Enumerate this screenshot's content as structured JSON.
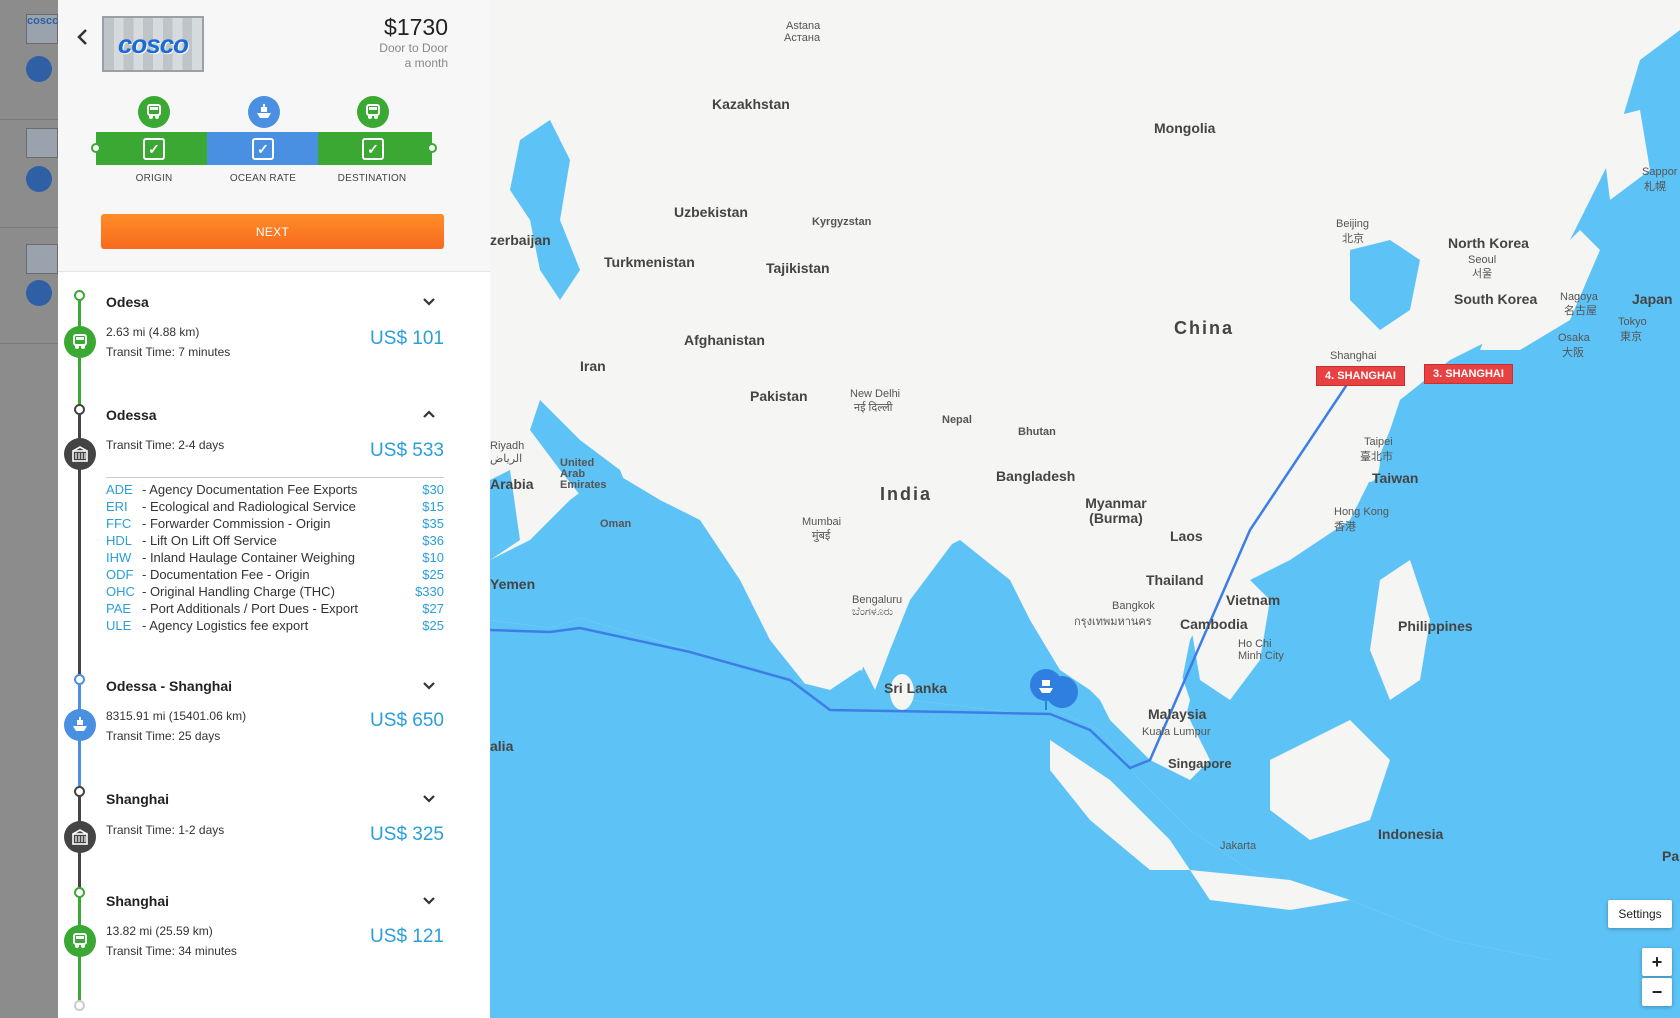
{
  "quote": {
    "carrier_logo_text": "cosco",
    "price": "$1730",
    "service": "Door to Door",
    "period": "a month"
  },
  "steps": [
    {
      "label": "ORIGIN",
      "color": "#3aa832",
      "icon": "truck-icon"
    },
    {
      "label": "OCEAN RATE",
      "color": "#4a90e2",
      "icon": "ship-icon"
    },
    {
      "label": "DESTINATION",
      "color": "#3aa832",
      "icon": "truck-icon"
    }
  ],
  "next_label": "NEXT",
  "legs": [
    {
      "title": "Odesa",
      "info1": "2.63 mi (4.88 km)",
      "info2": "Transit Time: 7 minutes",
      "price": "US$ 101",
      "icon": "truck-icon"
    },
    {
      "title": "Odessa",
      "info1": "Transit Time: 2-4 days",
      "price": "US$ 533",
      "icon": "port-icon",
      "expanded": true
    },
    {
      "title": "Odessa - Shanghai",
      "info1": "8315.91 mi (15401.06 km)",
      "info2": "Transit Time: 25 days",
      "price": "US$ 650",
      "icon": "ship-icon"
    },
    {
      "title": "Shanghai",
      "info1": "Transit Time: 1-2 days",
      "price": "US$ 325",
      "icon": "port-icon"
    },
    {
      "title": "Shanghai",
      "info1": "13.82 mi (25.59 km)",
      "info2": "Transit Time: 34 minutes",
      "price": "US$ 121",
      "icon": "truck-icon"
    }
  ],
  "fees": [
    {
      "code": "ADE",
      "name": "- Agency Documentation Fee Exports",
      "amount": "$30"
    },
    {
      "code": "ERI",
      "name": "- Ecological and Radiological Service",
      "amount": "$15"
    },
    {
      "code": "FFC",
      "name": "- Forwarder Commission - Origin",
      "amount": "$35"
    },
    {
      "code": "HDL",
      "name": "- Lift On Lift Off Service",
      "amount": "$36"
    },
    {
      "code": "IHW",
      "name": "- Inland Haulage Container Weighing",
      "amount": "$10"
    },
    {
      "code": "ODF",
      "name": "- Documentation Fee - Origin",
      "amount": "$25"
    },
    {
      "code": "OHC",
      "name": "- Original Handling Charge (THC)",
      "amount": "$330"
    },
    {
      "code": "PAE",
      "name": "- Port Additionals / Port Dues - Export",
      "amount": "$27"
    },
    {
      "code": "ULE",
      "name": "- Agency Logistics fee export",
      "amount": "$25"
    }
  ],
  "map": {
    "countries": [
      "Kazakhstan",
      "Mongolia",
      "Uzbekistan",
      "Kyrgyzstan",
      "zerbaijan",
      "Turkmenistan",
      "Tajikistan",
      "Afghanistan",
      "Iran",
      "Pakistan",
      "China",
      "North Korea",
      "South Korea",
      "Japan",
      "India",
      "Nepal",
      "Bhutan",
      "Bangladesh",
      "Myanmar (Burma)",
      "Laos",
      "Thailand",
      "Vietnam",
      "Cambodia",
      "Philippines",
      "Malaysia",
      "Indonesia",
      "Sri Lanka",
      "Taiwan",
      "Yemen",
      "Oman",
      "Arabia",
      "United Arab Emirates",
      "alia",
      "Pa"
    ],
    "cities": [
      "Astana",
      "Астана",
      "Beijing",
      "北京",
      "Seoul",
      "서울",
      "Nagoya",
      "名古屋",
      "Tokyo",
      "東京",
      "Osaka",
      "大阪",
      "Shanghai",
      "Taipei",
      "臺北市",
      "Hong Kong",
      "香港",
      "New Delhi",
      "नई दिल्ली",
      "Mumbai",
      "मुंबई",
      "Bengaluru",
      "ಬೆಂಗಳೂರು",
      "Bangkok",
      "กรุงเทพมหานคร",
      "Ho Chi Minh City",
      "Kuala Lumpur",
      "Singapore",
      "Jakarta",
      "Riyadh",
      "الرياض",
      "Sappor",
      "札幌"
    ],
    "badges": {
      "left": "4. SHANGHAI",
      "right": "3. SHANGHAI"
    },
    "settings_label": "Settings",
    "zoom_in": "+",
    "zoom_out": "−"
  }
}
